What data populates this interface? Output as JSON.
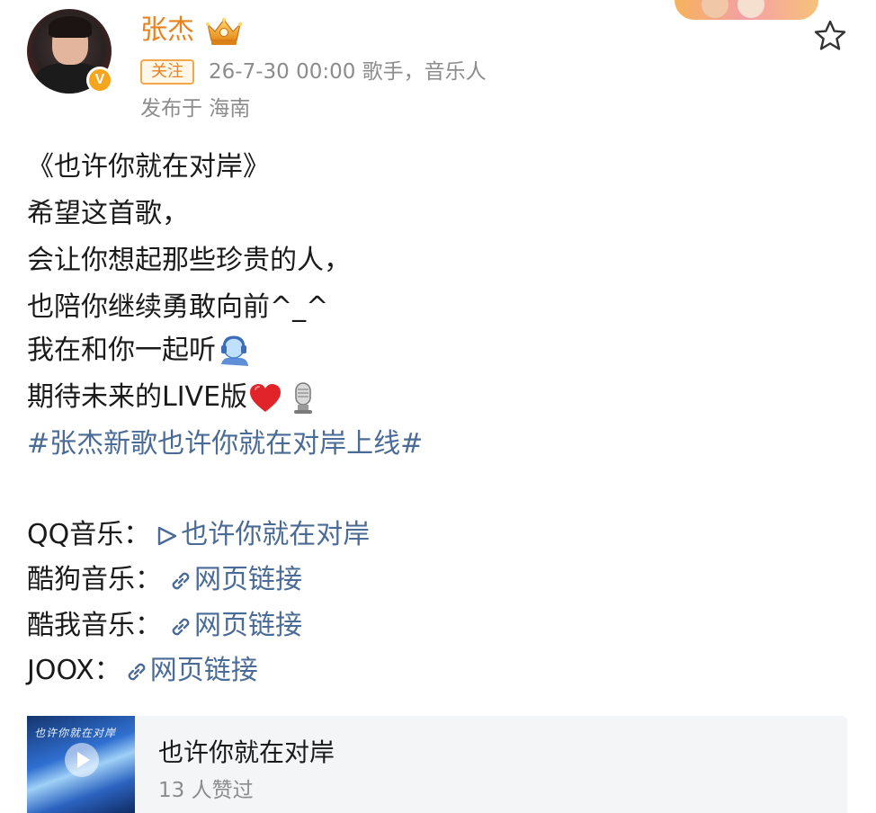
{
  "header": {
    "author_name": "张杰",
    "follow_label": "关注",
    "meta": "26-7-30 00:00  歌手，音乐人",
    "location": "发布于 海南",
    "vip_badge": "V"
  },
  "post": {
    "lines": [
      "《也许你就在对岸》",
      "希望这首歌，",
      "会让你想起那些珍贵的人，",
      "也陪你继续勇敢向前^_^",
      "我在和你一起听",
      "期待未来的LIVE版"
    ],
    "hashtag": "#张杰新歌也许你就在对岸上线#",
    "sources": [
      {
        "platform": "QQ音乐：",
        "link": "也许你就在对岸",
        "icon": "play-outline-icon"
      },
      {
        "platform": "酷狗音乐：",
        "link": "网页链接",
        "icon": "link-icon"
      },
      {
        "platform": "酷我音乐：",
        "link": "网页链接",
        "icon": "link-icon"
      },
      {
        "platform": "JOOX：",
        "link": "网页链接",
        "icon": "link-icon"
      }
    ]
  },
  "music_card": {
    "title": "也许你就在对岸",
    "likes": "13 人赞过",
    "cover_script": "也许你就在对岸"
  },
  "colors": {
    "author": "#e8821e",
    "link": "#4a6b96",
    "meta": "#8c8c8c"
  }
}
